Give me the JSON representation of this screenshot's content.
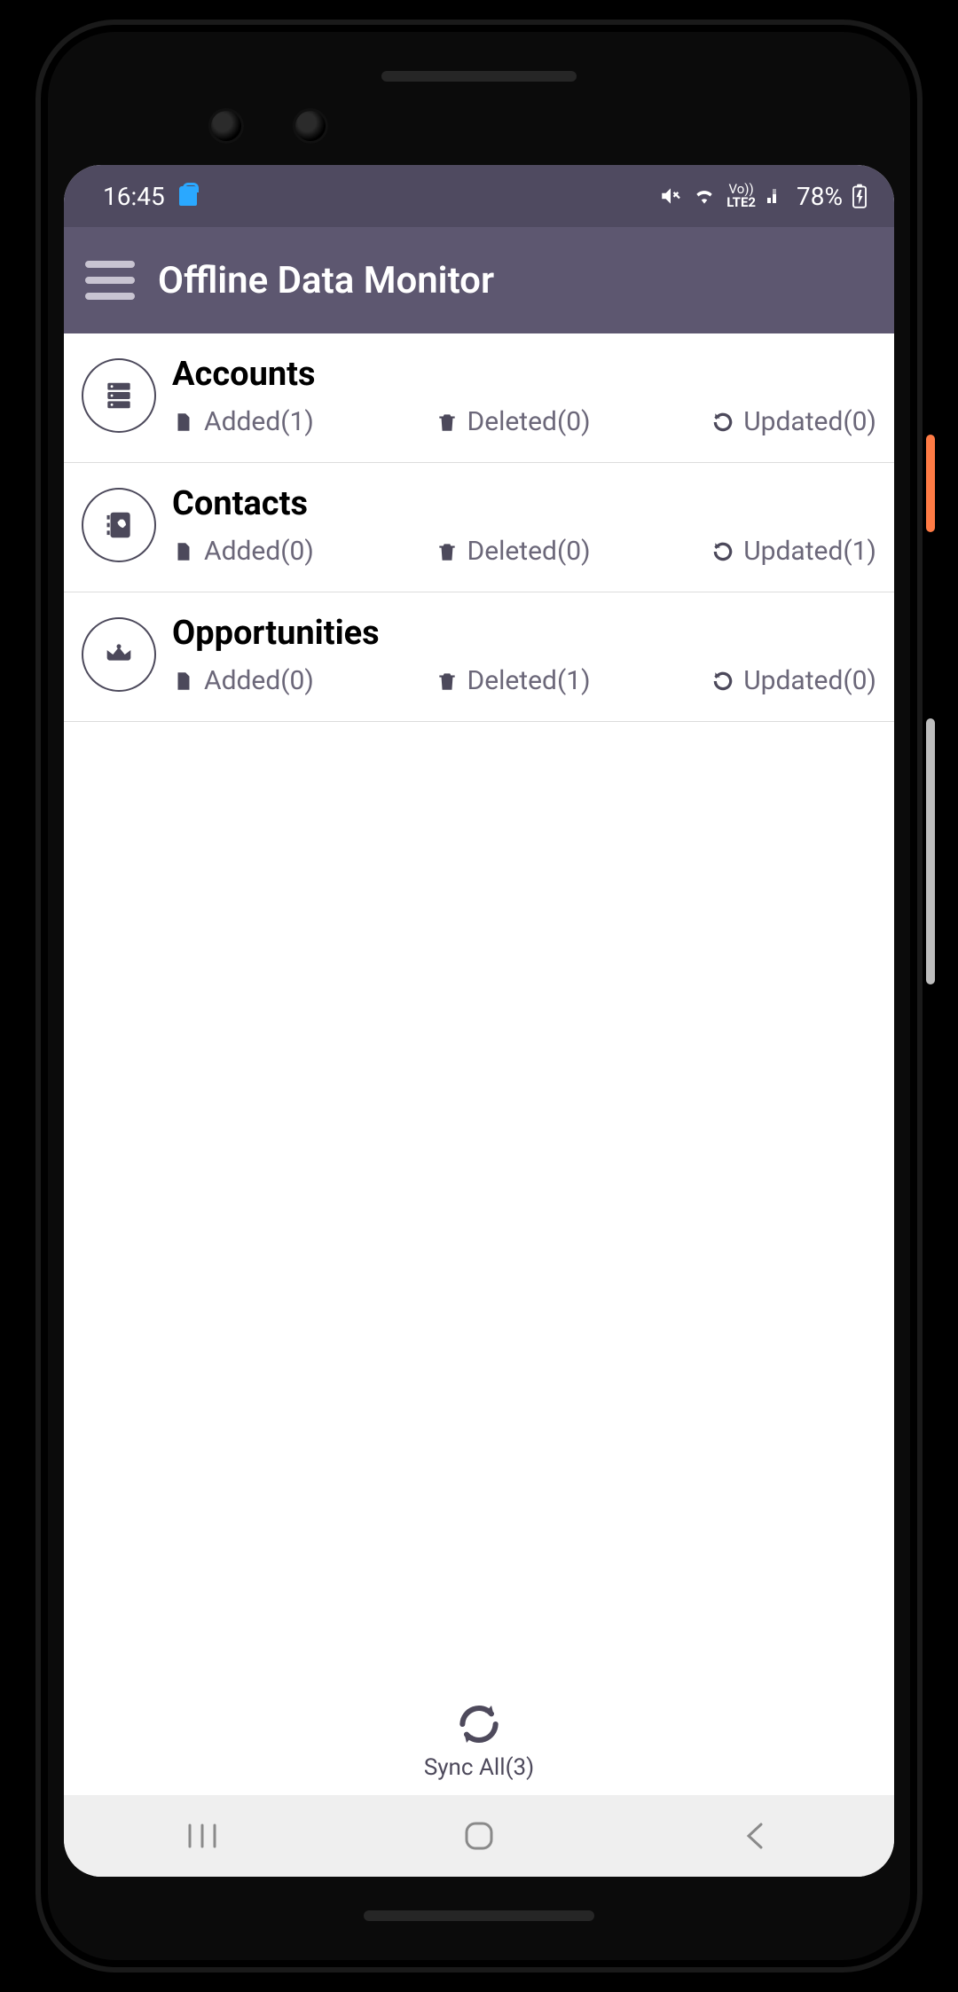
{
  "status": {
    "time": "16:45",
    "battery": "78%",
    "lte_label": "LTE2",
    "volte_label": "Vo))"
  },
  "header": {
    "title": "Offline Data Monitor"
  },
  "labels": {
    "added": "Added",
    "deleted": "Deleted",
    "updated": "Updated"
  },
  "items": [
    {
      "icon": "accounts",
      "title": "Accounts",
      "added": 1,
      "deleted": 0,
      "updated": 0
    },
    {
      "icon": "contacts",
      "title": "Contacts",
      "added": 0,
      "deleted": 0,
      "updated": 1
    },
    {
      "icon": "opportunities",
      "title": "Opportunities",
      "added": 0,
      "deleted": 1,
      "updated": 0
    }
  ],
  "sync": {
    "label": "Sync All",
    "count": 3
  }
}
